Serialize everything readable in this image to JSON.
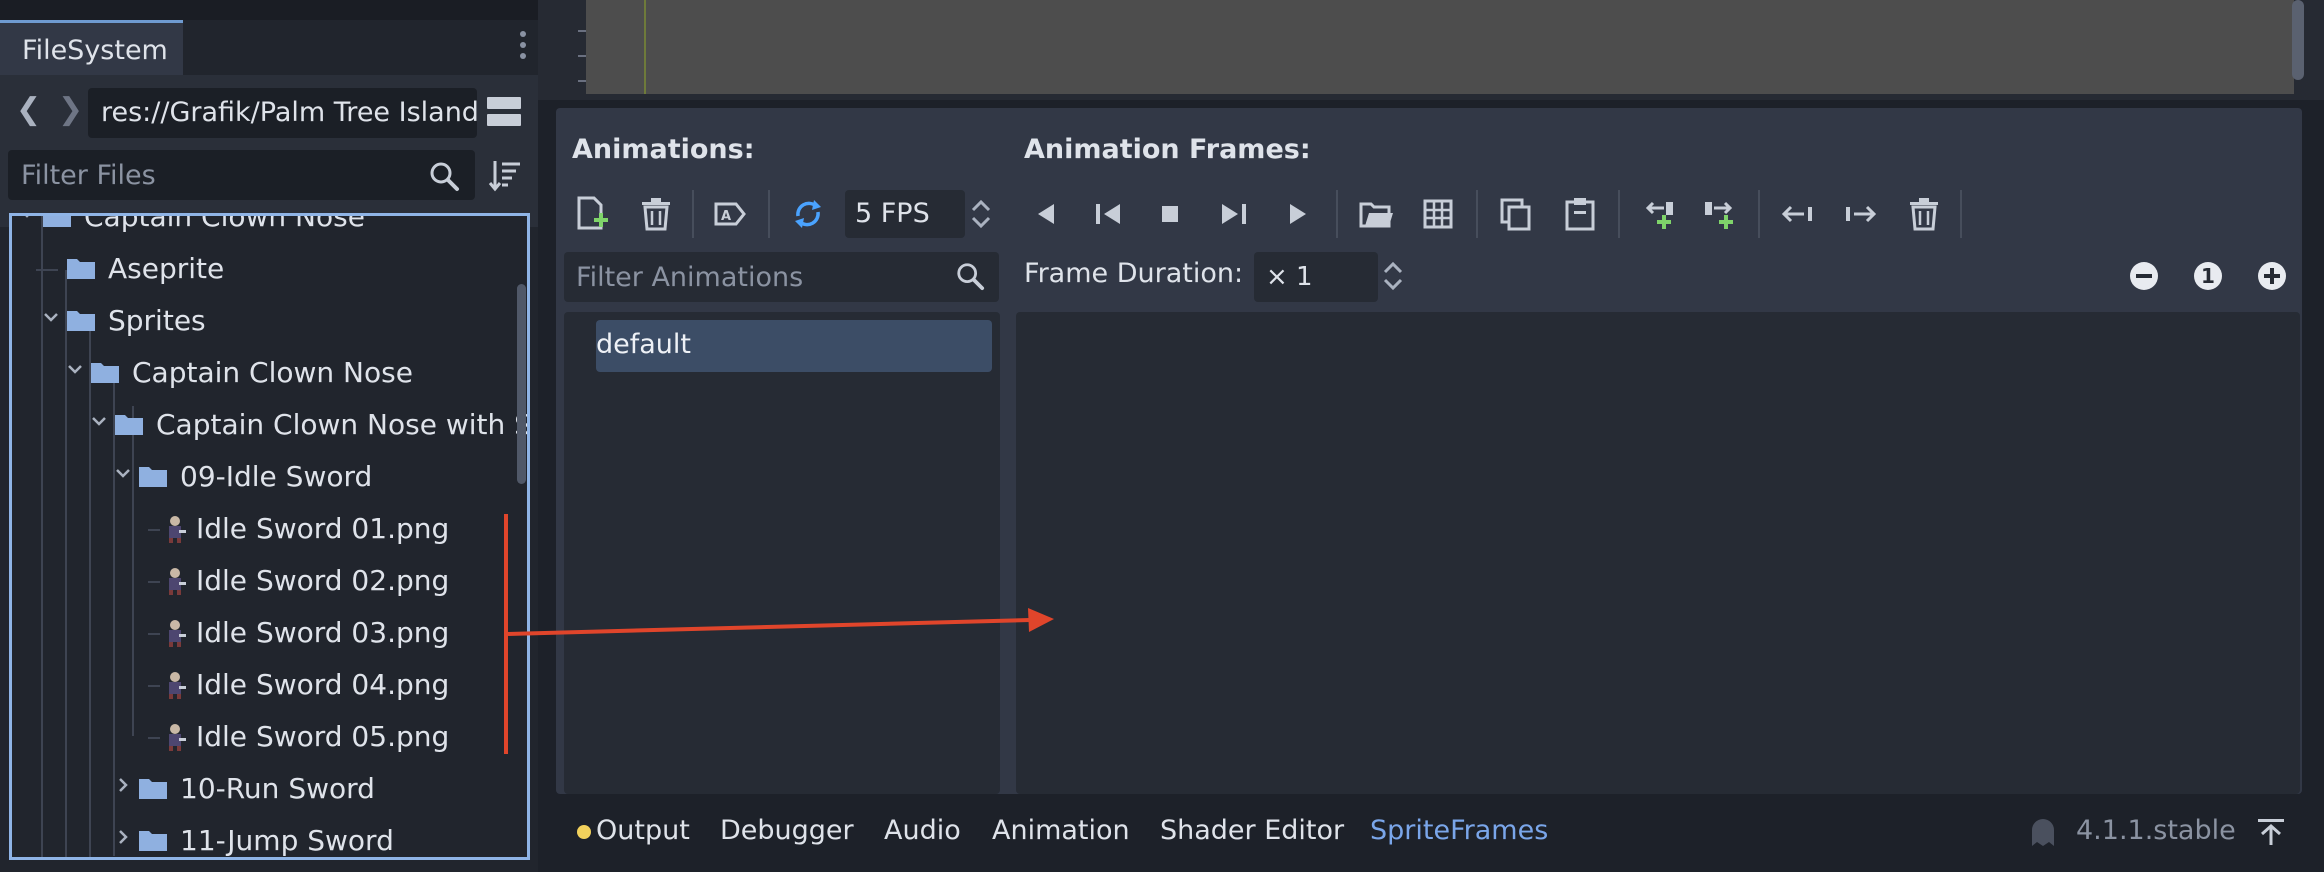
{
  "filesystem": {
    "tab_label": "FileSystem",
    "path": "res://Grafik/Palm Tree Island/Sprites/Captain Clown Nose",
    "filter_placeholder": "Filter Files",
    "tree": [
      {
        "label": "Captain Clown Nose",
        "type": "folder",
        "depth": 0,
        "expanded": true
      },
      {
        "label": "Aseprite",
        "type": "folder",
        "depth": 1,
        "expanded": null
      },
      {
        "label": "Sprites",
        "type": "folder",
        "depth": 1,
        "expanded": true
      },
      {
        "label": "Captain Clown Nose",
        "type": "folder",
        "depth": 2,
        "expanded": true
      },
      {
        "label": "Captain Clown Nose with Sword",
        "type": "folder",
        "depth": 3,
        "expanded": true
      },
      {
        "label": "09-Idle Sword",
        "type": "folder",
        "depth": 4,
        "expanded": true
      },
      {
        "label": "Idle Sword 01.png",
        "type": "file",
        "depth": 5
      },
      {
        "label": "Idle Sword 02.png",
        "type": "file",
        "depth": 5
      },
      {
        "label": "Idle Sword 03.png",
        "type": "file",
        "depth": 5
      },
      {
        "label": "Idle Sword 04.png",
        "type": "file",
        "depth": 5
      },
      {
        "label": "Idle Sword 05.png",
        "type": "file",
        "depth": 5
      },
      {
        "label": "10-Run Sword",
        "type": "folder",
        "depth": 4,
        "expanded": false
      },
      {
        "label": "11-Jump Sword",
        "type": "folder",
        "depth": 4,
        "expanded": false
      }
    ]
  },
  "spriteframes": {
    "animations_header": "Animations:",
    "frames_header": "Animation Frames:",
    "fps_value": "5 FPS",
    "filter_animations_placeholder": "Filter Animations",
    "frame_duration_label": "Frame Duration:",
    "frame_duration_value": "× 1",
    "animations": [
      "default"
    ],
    "selected_animation": "default"
  },
  "bottom_tabs": [
    "Output",
    "Debugger",
    "Audio",
    "Animation",
    "Shader Editor",
    "SpriteFrames"
  ],
  "active_bottom_tab": "SpriteFrames",
  "version": "4.1.1.stable",
  "colors": {
    "accent": "#6f9bd1",
    "active_tab_text": "#7aa6ea",
    "folder": "#8fb0e0",
    "loop_icon": "#4aa3ff",
    "add_green": "#7fd46a",
    "annotation_arrow": "#e0452b",
    "output_dot": "#f2d15c"
  }
}
